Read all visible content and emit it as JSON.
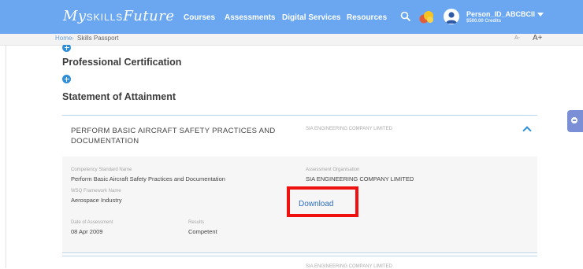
{
  "nav": {
    "logo_prefix": "My",
    "logo_mid": "SKILLS",
    "logo_suffix": "Future",
    "links": [
      "Courses",
      "Assessments",
      "Digital Services",
      "Resources"
    ],
    "user_name": "Person_ID_ABCBCII",
    "credits": "$500.00 Credits",
    "colors": {
      "bar": "#6aa7f0"
    }
  },
  "breadcrumb": {
    "home": "Home",
    "separator": "›",
    "current": "Skills Passport",
    "font_small": "A-",
    "font_large": "A+"
  },
  "sections": {
    "professional_certification": "Professional Certification",
    "statement_of_attainment": "Statement of Attainment"
  },
  "card": {
    "title": "PERFORM BASIC AIRCRAFT SAFETY PRACTICES AND DOCUMENTATION",
    "organisation": "SIA ENGINEERING COMPANY LIMITED",
    "details": {
      "competency_label": "Competency Standard Name",
      "competency_value": "Perform Basic Aircraft Safety Practices and Documentation",
      "assessment_org_label": "Assessment Organisation",
      "assessment_org_value": "SIA ENGINEERING COMPANY LIMITED",
      "wsq_label": "WSQ Framework Name",
      "wsq_value": "Aerospace Industry",
      "download_label": "Download",
      "date_label": "Date of Assessment",
      "date_value": "08 Apr 2009",
      "results_label": "Results",
      "results_value": "Competent"
    }
  },
  "next_card": {
    "organisation": "SIA ENGINEERING COMPANY LIMITED"
  },
  "highlight_color": "#ef1010"
}
